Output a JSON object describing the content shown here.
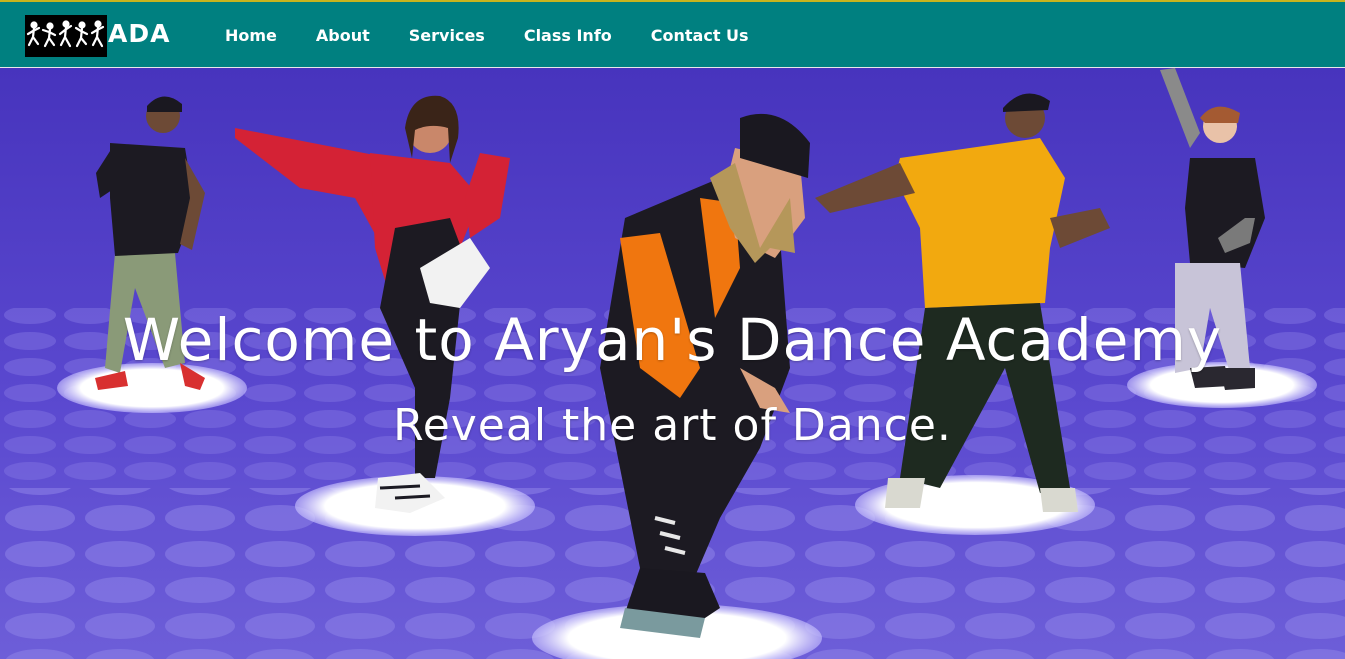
{
  "header": {
    "brand": "ADA",
    "nav": [
      "Home",
      "About",
      "Services",
      "Class Info",
      "Contact Us"
    ]
  },
  "hero": {
    "title": "Welcome to Aryan's Dance Academy",
    "subtitle": "Reveal the art of Dance."
  },
  "colors": {
    "header_bg": "#008080",
    "hero_bg": "#4a3cc0",
    "text": "#ffffff"
  }
}
